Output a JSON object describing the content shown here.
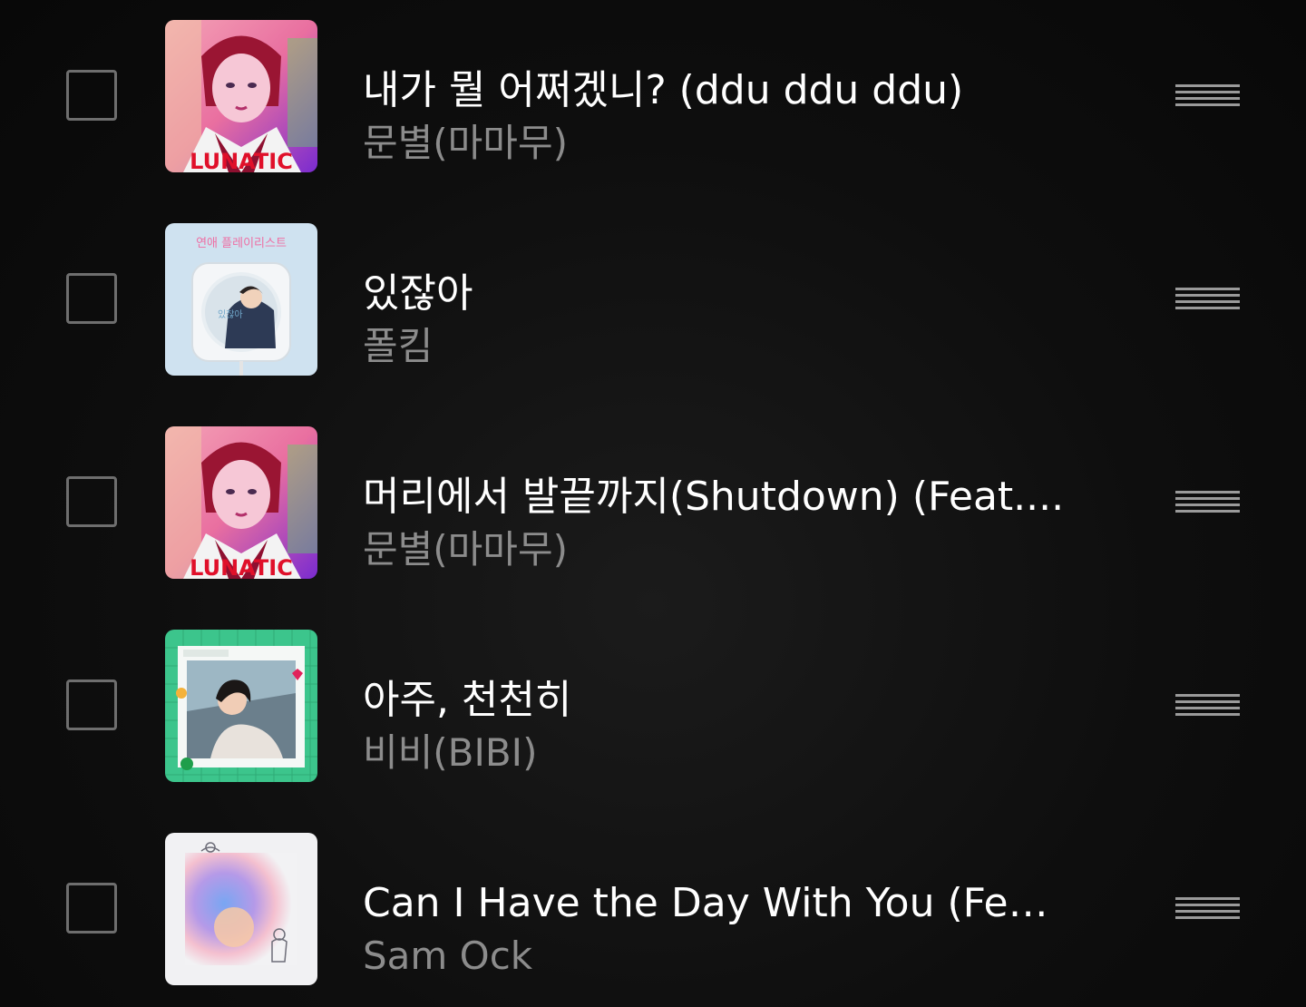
{
  "songs": [
    {
      "title": "내가 뭘 어쩌겠니? (ddu ddu ddu)",
      "artist": "문별(마마무)",
      "cover": "lunatic-cover",
      "cover_text": "LUNATIC"
    },
    {
      "title": "있잖아",
      "artist": "폴킴",
      "cover": "cd-player-cover",
      "cover_text": "연애 플레이리스트"
    },
    {
      "title": "머리에서 발끝까지(Shutdown) (Feat....",
      "artist": "문별(마마무)",
      "cover": "lunatic-cover",
      "cover_text": "LUNATIC"
    },
    {
      "title": "아주, 천천히",
      "artist": "비비(BIBI)",
      "cover": "green-frame-cover",
      "cover_text": ""
    },
    {
      "title": "Can I Have the Day With You (Feat....",
      "artist": "Sam Ock",
      "cover": "pastel-gradient-cover",
      "cover_text": ""
    }
  ],
  "colors": {
    "background": "#0d0d0d",
    "title": "#ffffff",
    "artist": "#8c8c8c",
    "checkbox_border": "#6e6e6e",
    "drag_handle": "#9a9a9a"
  },
  "icons": {
    "checkbox": "checkbox-empty-icon",
    "drag": "drag-handle-icon"
  }
}
